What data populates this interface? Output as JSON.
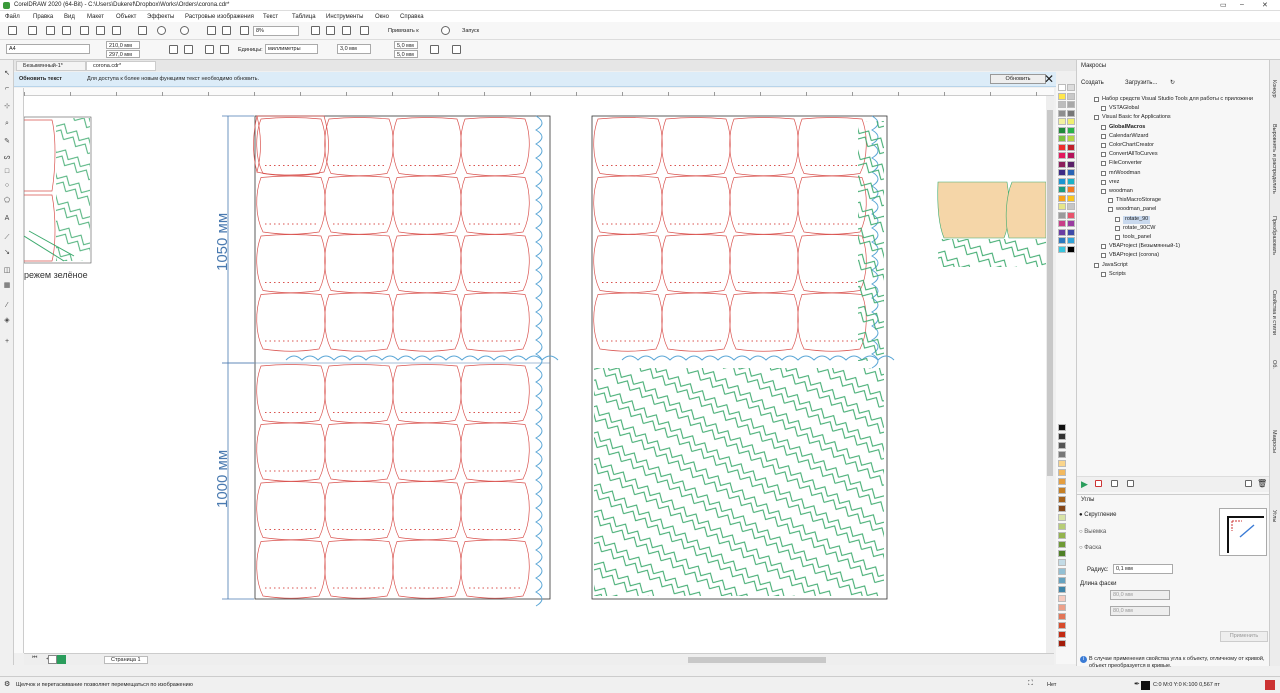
{
  "window": {
    "title": "CorelDRAW 2020 (64-Bit) - C:\\Users\\Dukeref\\Dropbox\\Works\\Orders\\corona.cdr*"
  },
  "menu": [
    "Файл",
    "Правка",
    "Вид",
    "Макет",
    "Объект",
    "Эффекты",
    "Растровые изображения",
    "Текст",
    "Таблица",
    "Инструменты",
    "Окно",
    "Справка"
  ],
  "toolbar": {
    "zoom": "8%",
    "snap": "Привязать к",
    "launch": "Запуск"
  },
  "propbar": {
    "page_size": "A4",
    "width": "210,0 мм",
    "height": "297,0 мм",
    "units_label": "Единицы:",
    "units": "миллиметры",
    "nudge": "3,0 мм",
    "dup_x": "5,0 мм",
    "dup_y": "5,0 мм"
  },
  "tabs": [
    "Безымянный-1*",
    "corona.cdr*"
  ],
  "notice": {
    "heading": "Обновить текст",
    "message": "Для доступа к более новым функциям текст необходимо обновить.",
    "button": "Обновить"
  },
  "canvas": {
    "label_left": "режем зелёное",
    "dim_top": "1050 мм",
    "dim_bottom": "1000 мм"
  },
  "page_nav": {
    "page": "Страница 1"
  },
  "macros": {
    "panel_title": "Макросы",
    "create": "Создать",
    "load": "Загрузить...",
    "tree": [
      {
        "label": "Набор средств Visual Studio Tools для работы с приложени",
        "d": 1,
        "bold": false
      },
      {
        "label": "VSTAGlobal",
        "d": 2,
        "bold": false
      },
      {
        "label": "Visual Basic for Applications",
        "d": 1,
        "bold": false
      },
      {
        "label": "GlobalMacros",
        "d": 2,
        "bold": true
      },
      {
        "label": "CalendarWizard",
        "d": 2,
        "bold": false
      },
      {
        "label": "ColorChartCreator",
        "d": 2,
        "bold": false
      },
      {
        "label": "ConvertAllToCurves",
        "d": 2,
        "bold": false
      },
      {
        "label": "FileConverter",
        "d": 2,
        "bold": false
      },
      {
        "label": "mrWoodman",
        "d": 2,
        "bold": false
      },
      {
        "label": "vrez",
        "d": 2,
        "bold": false
      },
      {
        "label": "woodman",
        "d": 2,
        "bold": false
      },
      {
        "label": "ThisMacroStorage",
        "d": 3,
        "bold": false
      },
      {
        "label": "woodman_panel",
        "d": 3,
        "bold": false
      },
      {
        "label": "rotate_90",
        "d": 4,
        "bold": false,
        "selected": true
      },
      {
        "label": "rotate_90CW",
        "d": 4,
        "bold": false
      },
      {
        "label": "tools_panel",
        "d": 4,
        "bold": false
      },
      {
        "label": "VBAProject (Безымянный-1)",
        "d": 2,
        "bold": false
      },
      {
        "label": "VBAProject (corona)",
        "d": 2,
        "bold": false
      },
      {
        "label": "JavaScript",
        "d": 1,
        "bold": false
      },
      {
        "label": "Scripts",
        "d": 2,
        "bold": false
      }
    ]
  },
  "corners": {
    "title": "Углы",
    "opt1": "Скругление",
    "opt2": "Выемка",
    "opt3": "Фаска",
    "radius_label": "Радиус:",
    "radius": "0,1 мм",
    "chamfer_label": "Длина фаски",
    "ch1": "80,0 мм",
    "ch2": "80,0 мм",
    "apply": "Применить",
    "note": "В случае применения свойства угла к объекту, отличному от кривой, объект преобразуется в кривые."
  },
  "right_tabs": [
    "Конкур",
    "Выровнять и распределить",
    "Преобразовать",
    "Свойства и стили",
    "Об.",
    "Макросы",
    "Углы"
  ],
  "status": {
    "hint": "Щелчок и перетаскивание позволяет перемещаться по изображению",
    "fill": "Нет",
    "outline": "C:0 M:0 Y:0 K:100  0,567 пт"
  },
  "colors": {
    "red": "#d9534f",
    "green": "#3daa6e",
    "blue": "#5aa6d6",
    "peach": "#f5d6a8"
  }
}
